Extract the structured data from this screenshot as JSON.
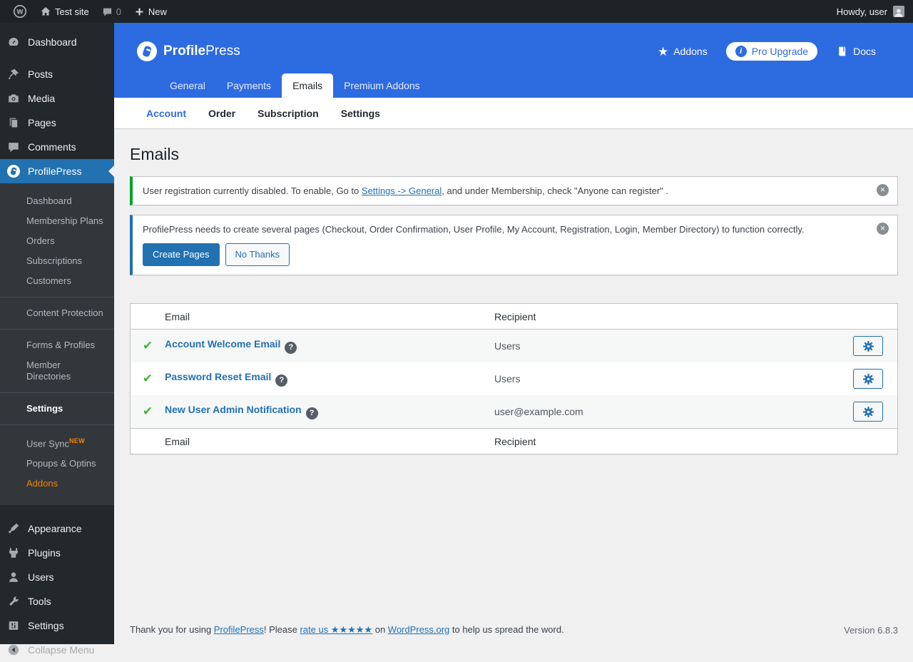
{
  "admin_bar": {
    "site_name": "Test site",
    "comment_count": "0",
    "new_label": "New",
    "howdy": "Howdy, user"
  },
  "icons": {
    "wp_logo_letter": "W",
    "star_glyph": "★",
    "info_glyph": "i",
    "help_glyph": "?",
    "dismiss_glyph": "✕",
    "check_glyph": "✔"
  },
  "sidebar": {
    "top_items": [
      {
        "label": "Dashboard"
      },
      {
        "label": "Posts"
      },
      {
        "label": "Media"
      },
      {
        "label": "Pages"
      },
      {
        "label": "Comments"
      },
      {
        "label": "ProfilePress"
      }
    ],
    "submenu": [
      {
        "label": "Dashboard"
      },
      {
        "label": "Membership Plans"
      },
      {
        "label": "Orders"
      },
      {
        "label": "Subscriptions"
      },
      {
        "label": "Customers"
      },
      {
        "label": "Content Protection"
      },
      {
        "label": "Forms & Profiles"
      },
      {
        "label": "Member Directories"
      },
      {
        "label": "Settings"
      },
      {
        "label": "User Sync",
        "badge": "NEW"
      },
      {
        "label": "Popups & Optins"
      },
      {
        "label": "Addons"
      }
    ],
    "bottom_items": [
      {
        "label": "Appearance"
      },
      {
        "label": "Plugins"
      },
      {
        "label": "Users"
      },
      {
        "label": "Tools"
      },
      {
        "label": "Settings"
      },
      {
        "label": "Collapse Menu"
      }
    ]
  },
  "header": {
    "brand_bold": "Profile",
    "brand_light": "Press",
    "addons_label": "Addons",
    "pro_upgrade_label": "Pro Upgrade",
    "docs_label": "Docs",
    "tabs": [
      {
        "label": "General"
      },
      {
        "label": "Payments"
      },
      {
        "label": "Emails"
      },
      {
        "label": "Premium Addons"
      }
    ],
    "subtabs": [
      {
        "label": "Account"
      },
      {
        "label": "Order"
      },
      {
        "label": "Subscription"
      },
      {
        "label": "Settings"
      }
    ]
  },
  "page": {
    "title": "Emails",
    "notice_registration": {
      "text_before": "User registration currently disabled. To enable, Go to ",
      "link": "Settings -> General",
      "text_after": ", and under Membership, check \"Anyone can register\" ."
    },
    "notice_pages": {
      "text": "ProfilePress needs to create several pages (Checkout, Order Confirmation, User Profile, My Account, Registration, Login, Member Directory) to function correctly.",
      "create_button": "Create Pages",
      "dismiss_button": "No Thanks"
    },
    "table": {
      "col_email": "Email",
      "col_recipient": "Recipient",
      "rows": [
        {
          "name": "Account Welcome Email",
          "recipient": "Users"
        },
        {
          "name": "Password Reset Email",
          "recipient": "Users"
        },
        {
          "name": "New User Admin Notification",
          "recipient": "user@example.com"
        }
      ]
    }
  },
  "footer": {
    "thanks_before": "Thank you for using ",
    "link_profilepress": "ProfilePress",
    "thanks_mid1": "! Please ",
    "link_rate": "rate us ★★★★★",
    "thanks_mid2": " on ",
    "link_wordpress": "WordPress.org",
    "thanks_after": " to help us spread the word.",
    "version": "Version 6.8.3"
  },
  "colors": {
    "accent_blue": "#2d6be1",
    "wp_link_blue": "#2271b1",
    "success_green": "#3db634",
    "addon_orange": "#f18500",
    "notice_green": "#00a32a"
  }
}
